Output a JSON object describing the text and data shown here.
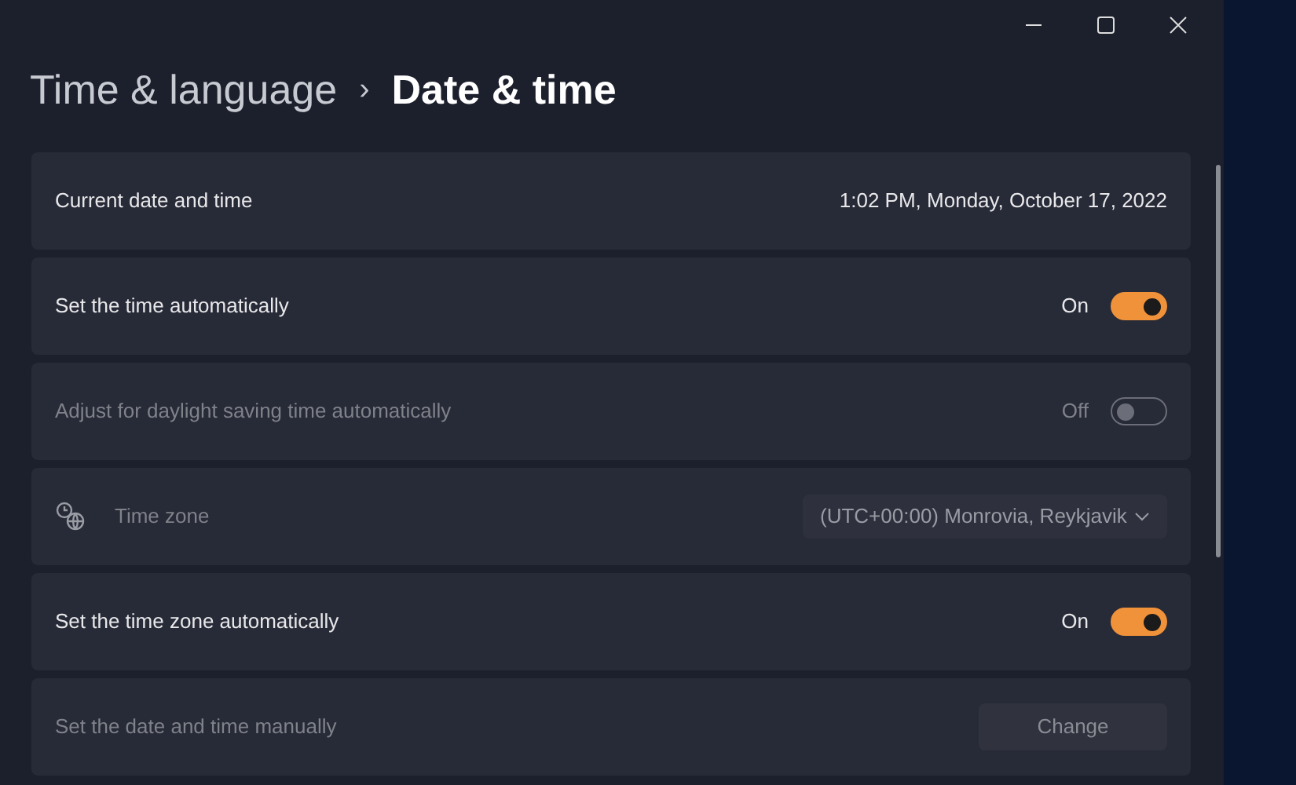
{
  "breadcrumb": {
    "parent": "Time & language",
    "separator": "›",
    "current": "Date & time"
  },
  "rows": [
    {
      "kind": "text",
      "label": "Current date and time",
      "value": "1:02 PM, Monday, October 17, 2022",
      "disabled": false
    },
    {
      "kind": "toggle",
      "label": "Set the time automatically",
      "state_label": "On",
      "on": true,
      "disabled": false
    },
    {
      "kind": "toggle",
      "label": "Adjust for daylight saving time automatically",
      "state_label": "Off",
      "on": false,
      "disabled": true
    },
    {
      "kind": "dropdown",
      "label": "Time zone",
      "value": "(UTC+00:00) Monrovia, Reykjavik",
      "disabled": true
    },
    {
      "kind": "toggle",
      "label": "Set the time zone automatically",
      "state_label": "On",
      "on": true,
      "disabled": false
    },
    {
      "kind": "button",
      "label": "Set the date and time manually",
      "button": "Change",
      "disabled": true
    }
  ]
}
